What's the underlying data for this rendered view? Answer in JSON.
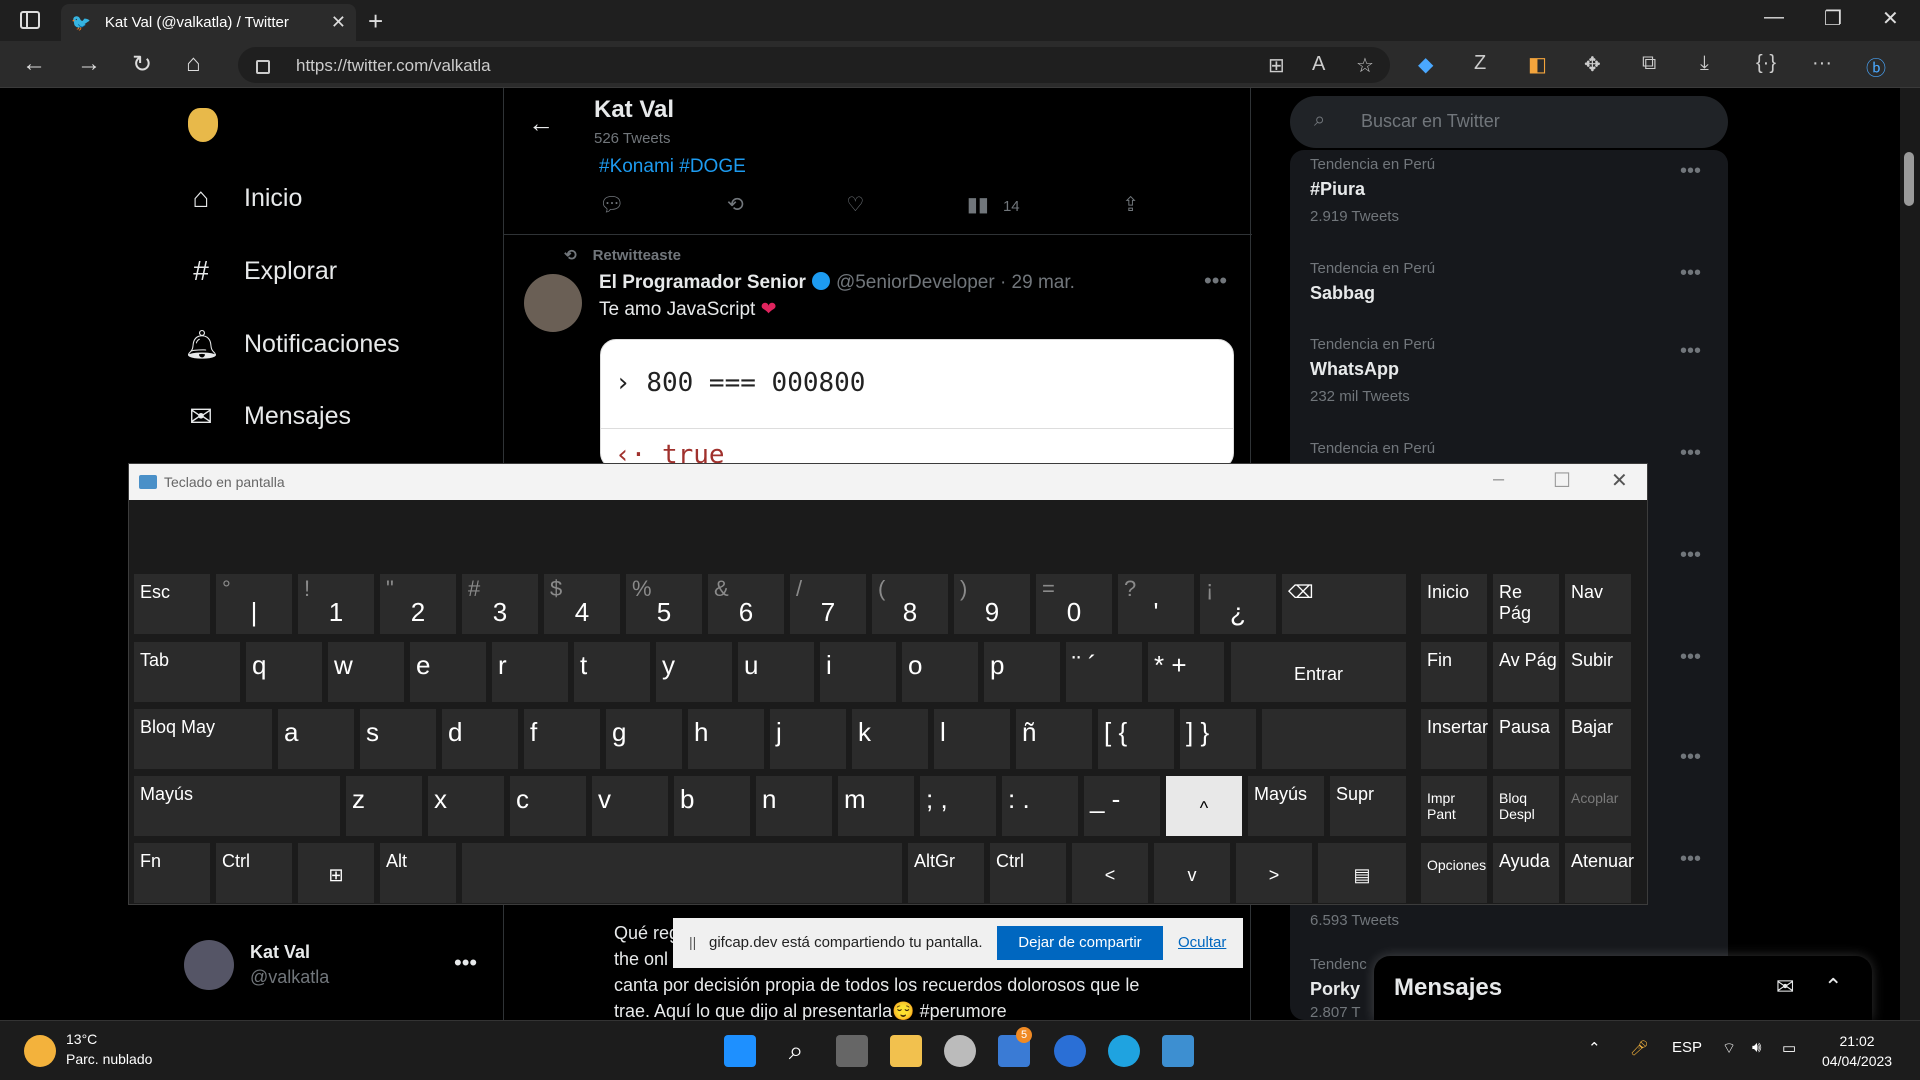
{
  "browser": {
    "tab_title": "Kat Val (@valkatla) / Twitter",
    "url": "https://twitter.com/valkatla"
  },
  "nav": {
    "items": [
      {
        "label": "Inicio",
        "icon": "home-icon"
      },
      {
        "label": "Explorar",
        "icon": "hashtag-icon"
      },
      {
        "label": "Notificaciones",
        "icon": "bell-icon"
      },
      {
        "label": "Mensajes",
        "icon": "mail-icon"
      }
    ],
    "profile_name": "Kat Val",
    "profile_handle": "@valkatla"
  },
  "header": {
    "title": "Kat Val",
    "tweets": "526 Tweets",
    "hashtags": "#Konami #DOGE",
    "views": "14"
  },
  "tweet": {
    "retweeted": "Retwitteaste",
    "author": "El Programador Senior",
    "handle": "@5eniorDeveloper",
    "date": "· 29 mar.",
    "text": "Te amo JavaScript",
    "code_line": "800 === 000800",
    "code_result": "true"
  },
  "tweet2": {
    "line1": "Qué reg",
    "line2": "the onl",
    "line3": "canta por decisión propia de todos los recuerdos dolorosos que le",
    "line4": "trae. Aquí lo que dijo al presentarla",
    "hashtag": "#perumore"
  },
  "search": {
    "placeholder": "Buscar en Twitter"
  },
  "trends": [
    {
      "context": "Tendencia en Perú",
      "name": "#Piura",
      "count": "2.919 Tweets"
    },
    {
      "context": "Tendencia en Perú",
      "name": "Sabbag",
      "count": ""
    },
    {
      "context": "Tendencia en Perú",
      "name": "WhatsApp",
      "count": "232 mil Tweets"
    },
    {
      "context": "Tendencia en Perú",
      "name": "",
      "count": ""
    }
  ],
  "trends_bottom": {
    "count_above": "6.593 Tweets",
    "context": "Tendenc",
    "name": "Porky",
    "count": "2.807 T"
  },
  "messages_drawer": {
    "title": "Mensajes"
  },
  "sharebar": {
    "message": "gifcap.dev está compartiendo tu pantalla.",
    "stop_label": "Dejar de compartir",
    "hide_label": "Ocultar"
  },
  "osk": {
    "title": "Teclado en pantalla",
    "row1": [
      {
        "s": "",
        "m": "Esc"
      },
      {
        "s": "°",
        "m": "|"
      },
      {
        "s": "!",
        "m": "1"
      },
      {
        "s": "\"",
        "m": "2"
      },
      {
        "s": "#",
        "m": "3"
      },
      {
        "s": "$",
        "m": "4"
      },
      {
        "s": "%",
        "m": "5"
      },
      {
        "s": "&",
        "m": "6"
      },
      {
        "s": "/",
        "m": "7"
      },
      {
        "s": "(",
        "m": "8"
      },
      {
        "s": ")",
        "m": "9"
      },
      {
        "s": "=",
        "m": "0"
      },
      {
        "s": "?",
        "m": "'"
      },
      {
        "s": "¡",
        "m": "¿"
      },
      {
        "s": "",
        "m": "⌫"
      }
    ],
    "row2": [
      "Tab",
      "q",
      "w",
      "e",
      "r",
      "t",
      "y",
      "u",
      "i",
      "o",
      "p",
      "¨ ´",
      "* +",
      "Entrar"
    ],
    "row3": [
      "Bloq May",
      "a",
      "s",
      "d",
      "f",
      "g",
      "h",
      "j",
      "k",
      "l",
      "ñ",
      "[ {",
      "] }"
    ],
    "row4": [
      "Mayús",
      "z",
      "x",
      "c",
      "v",
      "b",
      "n",
      "m",
      "; ,",
      ": .",
      "_ -",
      "^",
      "Mayús",
      "Supr"
    ],
    "row5": [
      "Fn",
      "Ctrl",
      "⊞",
      "Alt",
      "",
      "AltGr",
      "Ctrl",
      "<",
      "v",
      ">",
      "▤"
    ],
    "side": [
      "Inicio",
      "Re Pág",
      "Nav",
      "Fin",
      "Av Pág",
      "Subir",
      "Insertar",
      "Pausa",
      "Bajar",
      "Impr Pant",
      "Bloq Despl",
      "Acoplar",
      "Opciones",
      "Ayuda",
      "Atenuar"
    ]
  },
  "taskbar": {
    "temp": "13°C",
    "condition": "Parc. nublado",
    "lang": "ESP",
    "time": "21:02",
    "date": "04/04/2023",
    "badge": "5"
  }
}
